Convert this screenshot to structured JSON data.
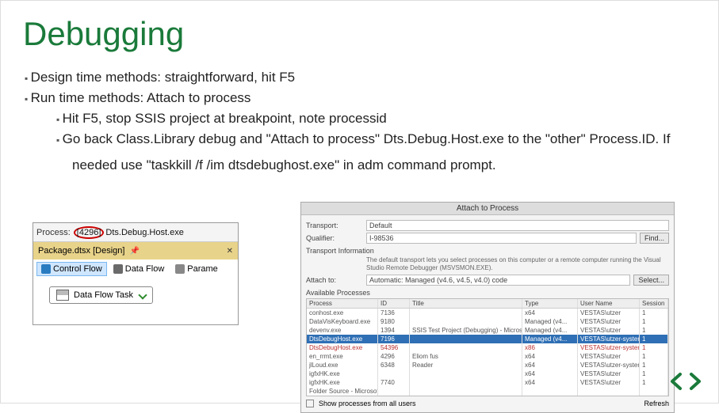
{
  "title": "Debugging",
  "bullets": {
    "b1": "Design time methods: straightforward, hit F5",
    "b2": "Run time methods: Attach to process",
    "b2a": "Hit F5, stop SSIS project at breakpoint, note processid",
    "b2b": "Go back Class.Library debug and \"Attach to process\" Dts.Debug.Host.exe to the \"other\" Process.ID. If",
    "b2c": "needed use \"taskkill /f /im dtsdebughost.exe\" in adm command prompt."
  },
  "left": {
    "process_label": "Process:",
    "pid": "[4296]",
    "proc_name": "Dts.Debug.Host.exe",
    "tab": "Package.dtsx [Design]",
    "tool_cf": "Control Flow",
    "tool_df": "Data Flow",
    "tool_pa": "Parame",
    "task": "Data Flow Task"
  },
  "right": {
    "title": "Attach to Process",
    "transport_label": "Transport:",
    "transport_val": "Default",
    "qualifier_label": "Qualifier:",
    "qualifier_val": "I-98536",
    "find": "Find...",
    "transport_info": "Transport Information",
    "info_text": "The default transport lets you select processes on this computer or a remote computer running the Visual Studio Remote Debugger (MSVSMON.EXE).",
    "attach_label": "Attach to:",
    "attach_val": "Automatic: Managed (v4.6, v4.5, v4.0) code",
    "select": "Select...",
    "avail": "Available Processes",
    "hdr": {
      "process": "Process",
      "id": "ID",
      "title": "Title",
      "type": "Type",
      "user": "User Name",
      "session": "Session"
    },
    "rows": [
      {
        "process": "conhost.exe",
        "id": "7136",
        "title": "",
        "type": "x64",
        "user": "VESTAS\\utzer",
        "session": "1"
      },
      {
        "process": "DataVisKeyboard.exe",
        "id": "9180",
        "title": "",
        "type": "Managed (v4...",
        "user": "VESTAS\\utzer",
        "session": "1"
      },
      {
        "process": "devenv.exe",
        "id": "1394",
        "title": "SSIS Test Project (Debugging) - Microsoft Visual...",
        "type": "Managed (v4...",
        "user": "VESTAS\\utzer",
        "session": "1"
      },
      {
        "process": "DtsDebugHost.exe",
        "id": "7196",
        "title": "",
        "type": "Managed (v4...",
        "user": "VESTAS\\utzer-system",
        "session": "1",
        "hl": true
      },
      {
        "process": "DtsDebugHost.exe",
        "id": "54396",
        "title": "",
        "type": "x86",
        "user": "VESTAS\\utzer-system",
        "session": "1",
        "red": true
      },
      {
        "process": "en_rrmt.exe",
        "id": "4296",
        "title": "Eliom fus",
        "type": "x64",
        "user": "VESTAS\\utzer",
        "session": "1"
      },
      {
        "process": "jlLoud.exe",
        "id": "6348",
        "title": "Reader",
        "type": "x64",
        "user": "VESTAS\\utzer-system",
        "session": "1"
      },
      {
        "process": "igfxHK.exe",
        "id": "",
        "title": "",
        "type": "x64",
        "user": "VESTAS\\utzer",
        "session": "1"
      },
      {
        "process": "igfxHK.exe",
        "id": "7740",
        "title": "",
        "type": "x64",
        "user": "VESTAS\\utzer",
        "session": "1"
      },
      {
        "process": "Folder Source - Microsoft Visual Studio",
        "id": "",
        "title": "",
        "type": "",
        "user": "",
        "session": ""
      }
    ],
    "show_all": "Show processes from all users",
    "refresh": "Refresh"
  }
}
